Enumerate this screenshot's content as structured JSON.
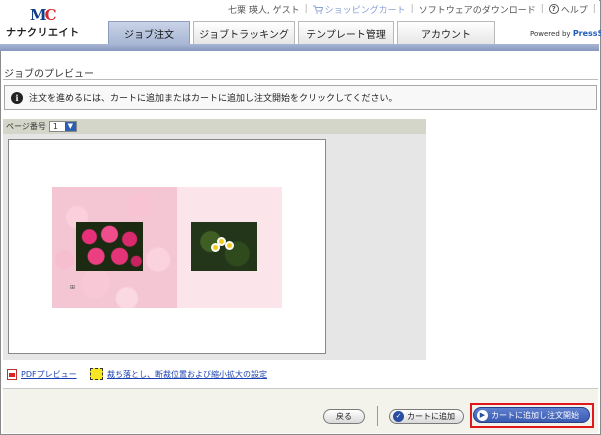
{
  "brand": {
    "mark": "MC",
    "name": "ナナクリエイト",
    "powered_prefix": "Powered by",
    "powered_brand": "PressSG"
  },
  "topnav": {
    "user": "七栗 瑛人, ゲスト",
    "cart": "ショッピングカート",
    "download": "ソフトウェアのダウンロード",
    "help": "ヘルプ"
  },
  "tabs": [
    {
      "label": "ジョブ注文",
      "active": true
    },
    {
      "label": "ジョブトラッキング"
    },
    {
      "label": "テンプレート管理"
    },
    {
      "label": "アカウント"
    }
  ],
  "page": {
    "title": "ジョブのプレビュー",
    "notice": "注文を進めるには、カートに追加またはカートに追加し注文開始をクリックしてください。"
  },
  "preview": {
    "page_label": "ページ番号",
    "page_value": "1"
  },
  "links": {
    "pdf": "PDFプレビュー",
    "bleed": "裁ち落とし、断裁位置および縮小拡大の設定"
  },
  "buttons": {
    "back": "戻る",
    "add_cart": "カートに追加",
    "add_start": "カートに追加し注文開始"
  },
  "colors": {
    "accent": "#3a5bb0",
    "highlight": "#e0181b",
    "nav_bar": "#a9b7d4"
  }
}
